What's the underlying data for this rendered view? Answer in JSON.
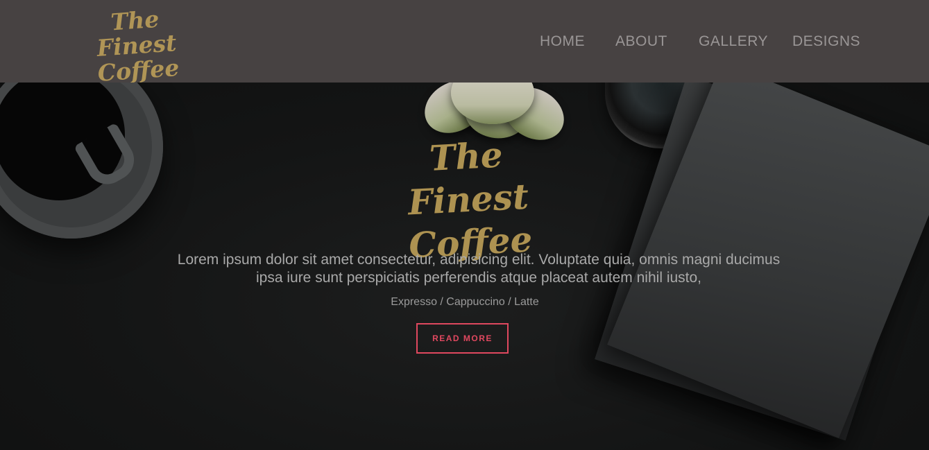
{
  "brand": {
    "logo_line1": "The Finest",
    "logo_line2": "Coffee",
    "logo_color": "#b09556"
  },
  "nav": {
    "items": [
      {
        "label": "HOME"
      },
      {
        "label": "ABOUT"
      },
      {
        "label": "GALLERY"
      },
      {
        "label": "DESIGNS"
      }
    ],
    "background": "#474242"
  },
  "hero": {
    "logo_line1": "The Finest",
    "logo_line2": "Coffee",
    "description": "Lorem ipsum dolor sit amet consectetur, adipisicing elit. Voluptate quia, omnis magni ducimus ipsa iure sunt perspiciatis perferendis atque placeat autem nihil iusto,",
    "subtitle": "Expresso / Cappuccino / Latte",
    "button_label": "READ MORE",
    "accent_color": "#e0485f"
  }
}
